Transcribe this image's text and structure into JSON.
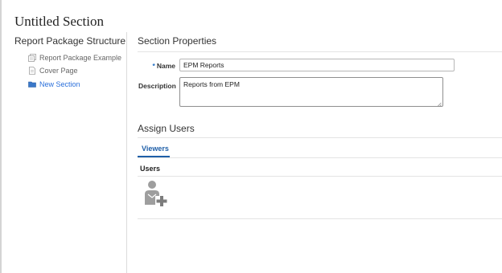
{
  "page": {
    "title": "Untitled Section"
  },
  "sidebar": {
    "heading": "Report Package Structure",
    "items": [
      {
        "label": "Report Package Example",
        "icon": "report-package-icon"
      },
      {
        "label": "Cover Page",
        "icon": "document-icon"
      },
      {
        "label": "New Section",
        "icon": "folder-icon",
        "active": true
      }
    ]
  },
  "section_properties": {
    "title": "Section Properties",
    "name_label": "Name",
    "required_marker": "*",
    "name_value": "EPM Reports",
    "description_label": "Description",
    "description_value": "Reports from EPM"
  },
  "assign_users": {
    "title": "Assign Users",
    "tabs": [
      {
        "label": "Viewers",
        "selected": true
      }
    ],
    "users_label": "Users",
    "add_user_icon": "add-user-icon"
  },
  "colors": {
    "accent": "#1f5fa8",
    "active_link": "#2a6fdb",
    "icon_gray": "#9e9e9e"
  }
}
